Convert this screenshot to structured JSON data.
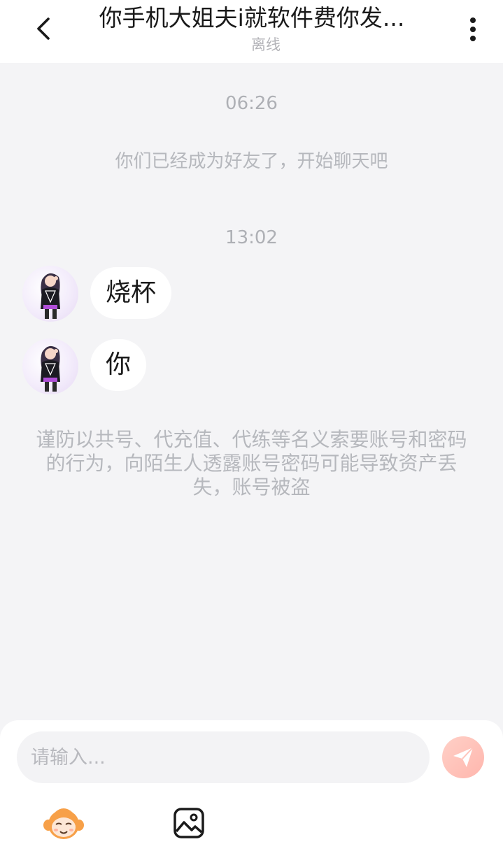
{
  "header": {
    "title": "你手机大姐夫i就软件费你发...",
    "status": "离线",
    "back_icon": "chevron-left-icon",
    "more_icon": "more-vertical-icon"
  },
  "chat": {
    "timestamp_1": "06:26",
    "friend_notice": "你们已经成为好友了，开始聊天吧",
    "timestamp_2": "13:02",
    "messages": [
      {
        "text": "烧杯"
      },
      {
        "text": "你"
      }
    ],
    "warning": "谨防以共号、代充值、代练等名义索要账号和密码的行为，向陌生人透露账号密码可能导致资产丢失，账号被盗"
  },
  "composer": {
    "placeholder": "请输入...",
    "send_icon": "send-icon",
    "emoji_icon": "emoji-icon",
    "image_icon": "image-icon"
  },
  "colors": {
    "background": "#f4f4f6",
    "send_accent": "#ffb6ad",
    "bubble": "#ffffff"
  }
}
